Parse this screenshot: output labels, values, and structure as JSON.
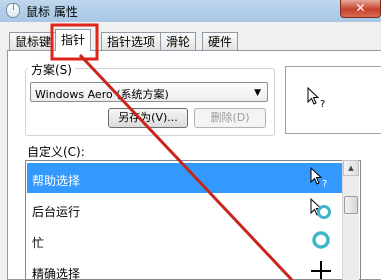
{
  "window": {
    "title": "鼠标 属性",
    "close_glyph": "✕"
  },
  "tabs": [
    {
      "label": "鼠标键"
    },
    {
      "label": "指针",
      "active": true
    },
    {
      "label": "指针选项"
    },
    {
      "label": "滑轮"
    },
    {
      "label": "硬件"
    }
  ],
  "scheme": {
    "label": "方案(S)",
    "selected": "Windows Aero (系统方案)",
    "save_as_label": "另存为(V)...",
    "delete_label": "删除(D)"
  },
  "customize": {
    "label": "自定义(C):",
    "items": [
      {
        "label": "帮助选择",
        "icon": "help-select-cursor-icon",
        "selected": true
      },
      {
        "label": "后台运行",
        "icon": "working-in-background-cursor-icon"
      },
      {
        "label": "忙",
        "icon": "busy-cursor-icon"
      },
      {
        "label": "精确选择",
        "icon": "precision-select-cursor-icon"
      }
    ]
  },
  "annotation": {
    "highlight_color": "#e0231b",
    "arrow_color": "#c8261c"
  },
  "colors": {
    "selection": "#3399ff",
    "window_bg": "#f0f0f0"
  }
}
